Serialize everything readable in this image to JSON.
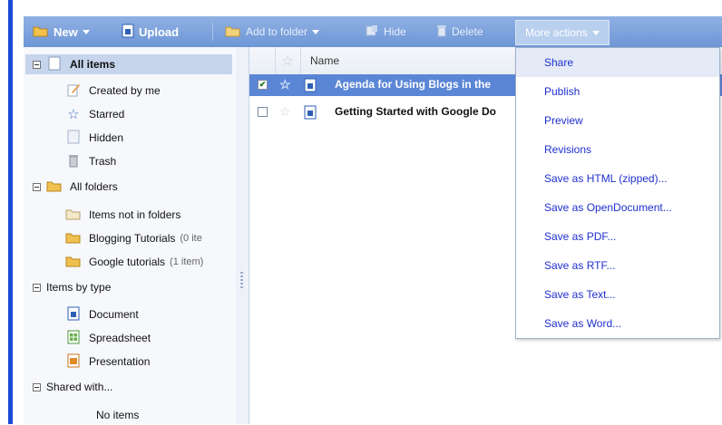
{
  "toolbar": {
    "new_label": "New",
    "upload_label": "Upload",
    "add_to_folder_label": "Add to folder",
    "hide_label": "Hide",
    "delete_label": "Delete",
    "more_actions_label": "More actions"
  },
  "sidebar": {
    "all_items": "All items",
    "created_by_me": "Created by me",
    "starred": "Starred",
    "hidden": "Hidden",
    "trash": "Trash",
    "all_folders": "All folders",
    "items_not_in_folders": "Items not in folders",
    "folders": [
      {
        "name": "Blogging Tutorials",
        "count": "(0 ite"
      },
      {
        "name": "Google tutorials",
        "count": "(1 item)"
      }
    ],
    "items_by_type": "Items by type",
    "types": [
      "Document",
      "Spreadsheet",
      "Presentation"
    ],
    "shared_with": "Shared with...",
    "no_items": "No items"
  },
  "list": {
    "name_header": "Name",
    "rows": [
      {
        "title": "Agenda for Using Blogs in the",
        "checked": true,
        "selected": true
      },
      {
        "title": "Getting Started with Google Do",
        "checked": false,
        "selected": false
      }
    ]
  },
  "menu": {
    "items": [
      "Share",
      "Publish",
      "Preview",
      "Revisions",
      "Save as HTML (zipped)...",
      "Save as OpenDocument...",
      "Save as PDF...",
      "Save as RTF...",
      "Save as Text...",
      "Save as Word..."
    ]
  },
  "colors": {
    "toolbar": "#7fa3de",
    "selection": "#5b86d6",
    "menu_link": "#1f2fcf",
    "left_accent": "#1c4ad8"
  },
  "icons": {
    "new": "folder-icon",
    "upload": "document-icon",
    "add_to_folder": "folder-icon",
    "hide": "hide-icon",
    "delete": "trash-icon"
  }
}
